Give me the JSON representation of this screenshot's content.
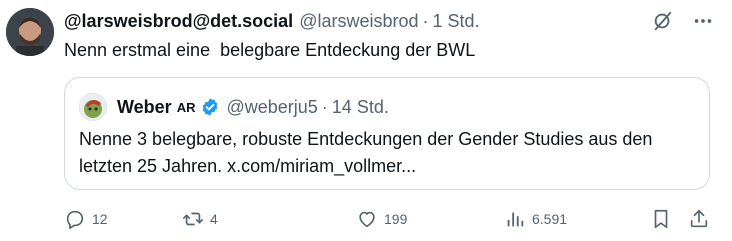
{
  "post": {
    "display_name": "@larsweisbrod@det.social",
    "handle": "@larsweisbrod",
    "separator": "·",
    "time": "1 Std.",
    "text": "Nenn erstmal eine  belegbare Entdeckung der BWL"
  },
  "quoted": {
    "display_name": "Weber",
    "name_suffix": "AR",
    "handle": "@weberju5",
    "separator": "·",
    "time": "14 Std.",
    "text_line1": "Nenne 3 belegbare, robuste Entdeckungen der Gender Studies aus den",
    "text_line2": "letzten 25 Jahren. x.com/miriam_vollmer..."
  },
  "actions": {
    "replies": "12",
    "reposts": "4",
    "likes": "199",
    "views": "6.591"
  },
  "icons": [
    "avatar",
    "grok-icon",
    "more-icon",
    "verified-badge-icon",
    "reply-icon",
    "repost-icon",
    "like-icon",
    "views-icon",
    "bookmark-icon",
    "share-icon"
  ],
  "colors": {
    "text": "#0f1419",
    "muted": "#536471",
    "border": "#cfd9de",
    "verified": "#1d9bf0"
  }
}
